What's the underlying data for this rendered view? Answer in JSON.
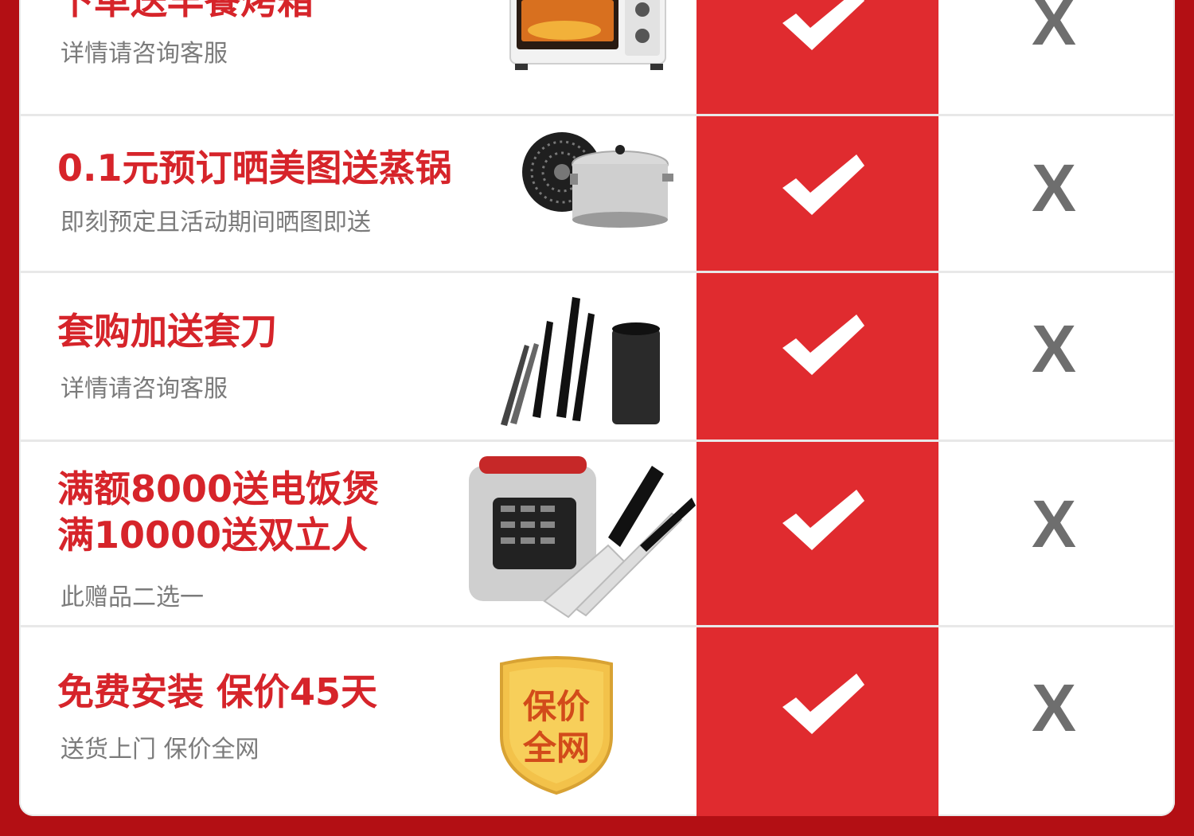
{
  "rows": [
    {
      "title": "下单送早餐烤箱",
      "subtitle": "详情请咨询客服"
    },
    {
      "title": "0.1元预订晒美图送蒸锅",
      "subtitle": "即刻预定且活动期间晒图即送"
    },
    {
      "title": "套购加送套刀",
      "subtitle": "详情请咨询客服"
    },
    {
      "title_line1": "满额8000送电饭煲",
      "title_line2": "满10000送双立人",
      "subtitle": "此赠品二选一"
    },
    {
      "title": "免费安装 保价45天",
      "subtitle": "送货上门 保价全网",
      "badge_line1": "保价",
      "badge_line2": "全网"
    }
  ],
  "compare": {
    "check_symbol": "check-icon",
    "x_label": "X"
  },
  "colors": {
    "brand_red": "#d6242a",
    "column_red": "#e02b2f",
    "frame_red": "#b30f14",
    "subtitle_gray": "#7b7b7b",
    "x_gray": "#6e6e6e"
  }
}
